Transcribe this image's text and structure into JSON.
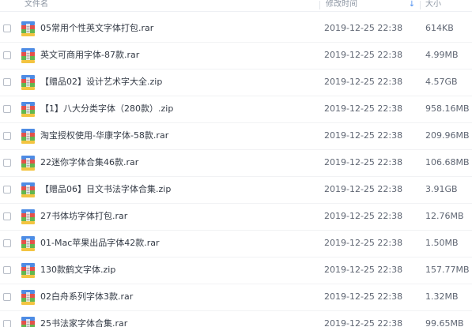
{
  "header": {
    "name_label": "文件名",
    "time_label": "修改时间",
    "size_label": "大小",
    "sort_indicator": "↓",
    "sort_icon": "arrow-down-icon"
  },
  "file_icon": "archive-file-icon",
  "colors": {
    "icon_blue": "#4e8ce4",
    "icon_red": "#e4514a",
    "icon_green": "#63b64f",
    "icon_yellow": "#f3c441",
    "sort_accent": "#4d8ff0"
  },
  "files": [
    {
      "name": "05常用个性英文字体打包.rar",
      "modified": "2019-12-25 22:38",
      "size": "614KB"
    },
    {
      "name": "英文可商用字体-87款.rar",
      "modified": "2019-12-25 22:38",
      "size": "4.99MB"
    },
    {
      "name": "【赠品02】设计艺术字大全.zip",
      "modified": "2019-12-25 22:38",
      "size": "4.57GB"
    },
    {
      "name": "【1】八大分类字体（280款）.zip",
      "modified": "2019-12-25 22:38",
      "size": "958.16MB"
    },
    {
      "name": "淘宝授权使用-华康字体-58款.rar",
      "modified": "2019-12-25 22:38",
      "size": "209.96MB"
    },
    {
      "name": "22迷你字体合集46款.rar",
      "modified": "2019-12-25 22:38",
      "size": "106.68MB"
    },
    {
      "name": "【赠品06】日文书法字体合集.zip",
      "modified": "2019-12-25 22:38",
      "size": "3.91GB"
    },
    {
      "name": "27书体坊字体打包.rar",
      "modified": "2019-12-25 22:38",
      "size": "12.76MB"
    },
    {
      "name": "01-Mac苹果出品字体42款.rar",
      "modified": "2019-12-25 22:38",
      "size": "1.50MB"
    },
    {
      "name": "130款鹤文字体.zip",
      "modified": "2019-12-25 22:38",
      "size": "157.77MB"
    },
    {
      "name": "02白舟系列字体3款.rar",
      "modified": "2019-12-25 22:38",
      "size": "1.32MB"
    },
    {
      "name": "25书法家字体合集.rar",
      "modified": "2019-12-25 22:38",
      "size": "99.65MB"
    }
  ]
}
